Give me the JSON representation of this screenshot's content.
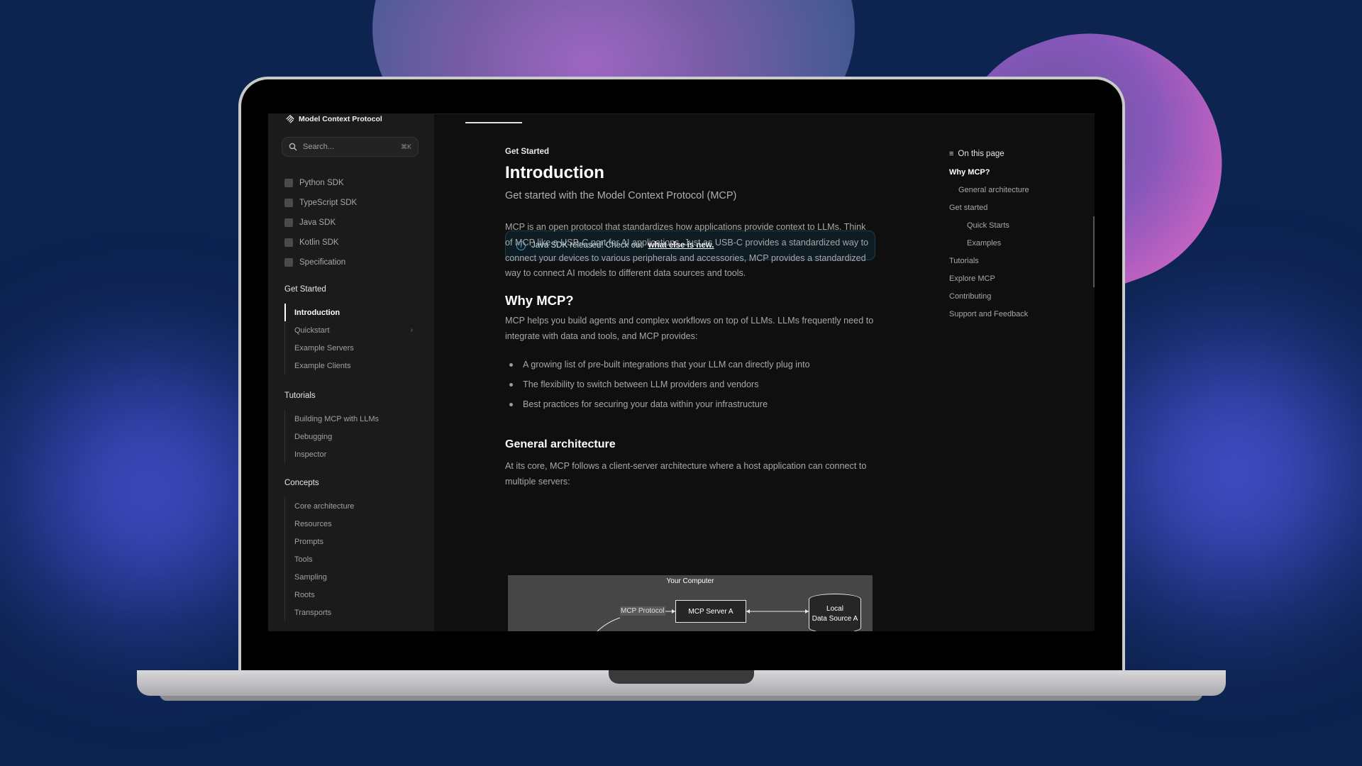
{
  "app": {
    "logo_text": "Model Context Protocol"
  },
  "search": {
    "placeholder": "Search...",
    "shortcut": "⌘K"
  },
  "sdks": [
    {
      "label": "Python SDK",
      "icon": "python-icon"
    },
    {
      "label": "TypeScript SDK",
      "icon": "typescript-icon"
    },
    {
      "label": "Java SDK",
      "icon": "java-icon"
    },
    {
      "label": "Kotlin SDK",
      "icon": "kotlin-icon"
    },
    {
      "label": "Specification",
      "icon": "document-icon"
    }
  ],
  "nav": {
    "get_started": {
      "heading": "Get Started",
      "items": [
        "Introduction",
        "Quickstart",
        "Example Servers",
        "Example Clients"
      ]
    },
    "tutorials": {
      "heading": "Tutorials",
      "items": [
        "Building MCP with LLMs",
        "Debugging",
        "Inspector"
      ]
    },
    "concepts": {
      "heading": "Concepts",
      "items": [
        "Core architecture",
        "Resources",
        "Prompts",
        "Tools",
        "Sampling",
        "Roots",
        "Transports"
      ]
    }
  },
  "page": {
    "eyebrow": "Get Started",
    "title": "Introduction",
    "subtitle": "Get started with the Model Context Protocol (MCP)",
    "callout_text": "Java SDK released! Check out",
    "callout_link": "what else is new.",
    "intro": "MCP is an open protocol that standardizes how applications provide context to LLMs. Think of MCP like a USB-C port for AI applications. Just as USB-C provides a standardized way to connect your devices to various peripherals and accessories, MCP provides a standardized way to connect AI models to different data sources and tools.",
    "why_heading": "Why MCP?",
    "why_text": "MCP helps you build agents and complex workflows on top of LLMs. LLMs frequently need to integrate with data and tools, and MCP provides:",
    "bullets": [
      "A growing list of pre-built integrations that your LLM can directly plug into",
      "The flexibility to switch between LLM providers and vendors",
      "Best practices for securing your data within your infrastructure"
    ],
    "arch_heading": "General architecture",
    "arch_text": "At its core, MCP follows a client-server architecture where a host application can connect to multiple servers:"
  },
  "diagram": {
    "title": "Your Computer",
    "protocol_label": "MCP Protocol",
    "server_label": "MCP Server A",
    "source_line1": "Local",
    "source_line2": "Data Source A"
  },
  "toc": {
    "heading": "On this page",
    "items": [
      {
        "label": "Why MCP?",
        "level": 1,
        "active": true
      },
      {
        "label": "General architecture",
        "level": 2
      },
      {
        "label": "Get started",
        "level": 1
      },
      {
        "label": "Quick Starts",
        "level": 3
      },
      {
        "label": "Examples",
        "level": 3
      },
      {
        "label": "Tutorials",
        "level": 1
      },
      {
        "label": "Explore MCP",
        "level": 1
      },
      {
        "label": "Contributing",
        "level": 1
      },
      {
        "label": "Support and Feedback",
        "level": 1
      }
    ]
  },
  "colors": {
    "background": "#0d2350",
    "screen": "#0f0f10",
    "sidebar": "#1b1b1c",
    "callout_accent": "#3aa0d6"
  }
}
